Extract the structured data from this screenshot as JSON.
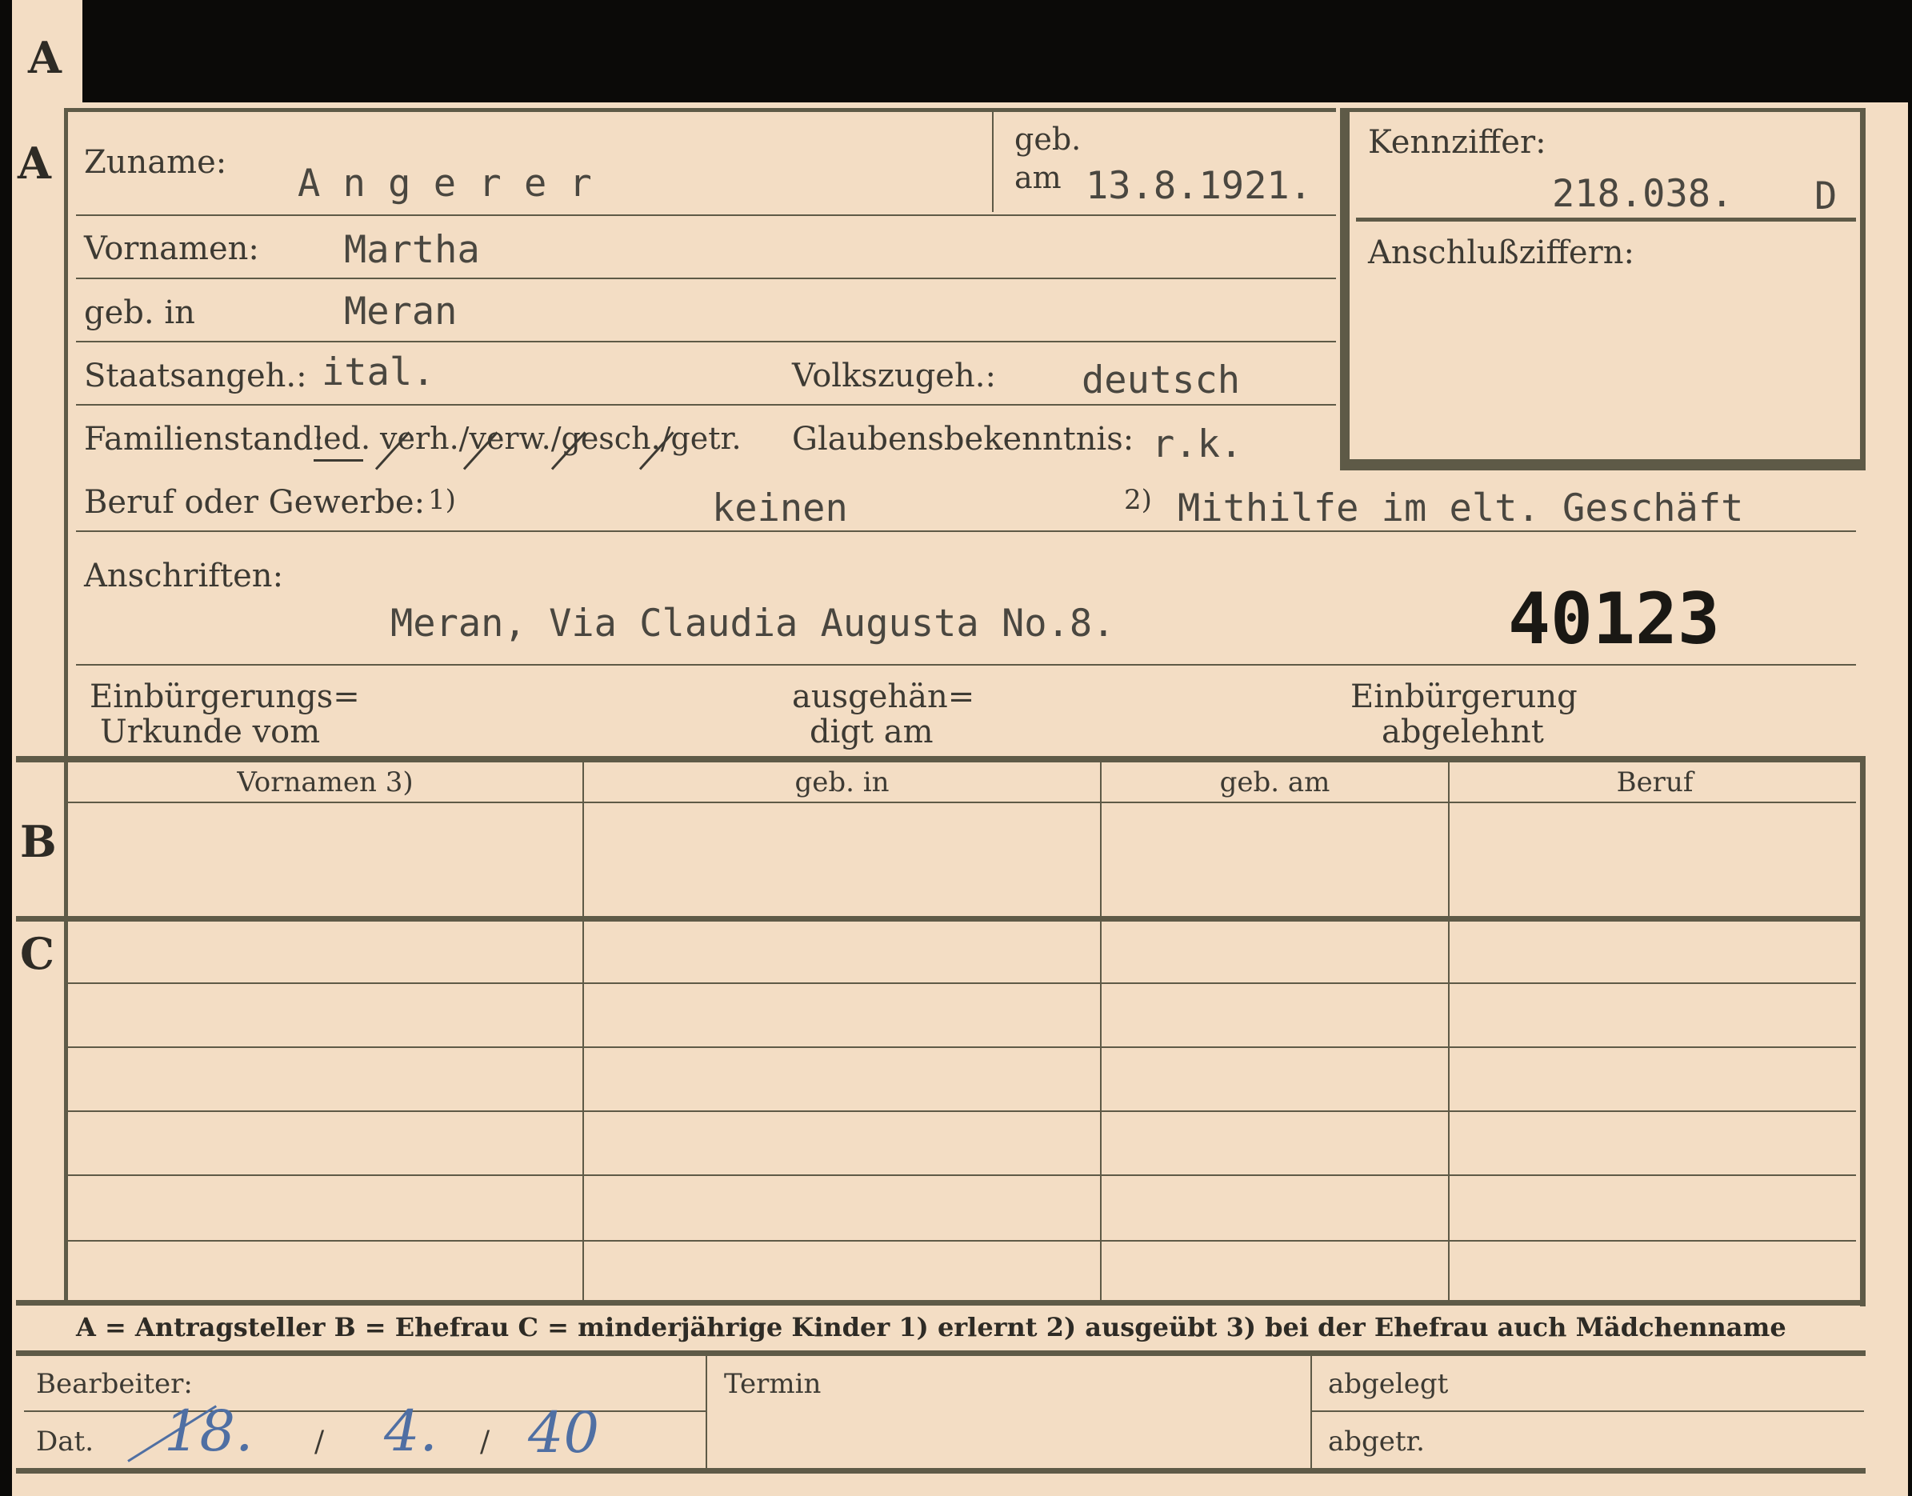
{
  "section_letters": {
    "a_tab": "A",
    "a": "A",
    "b": "B",
    "c": "C"
  },
  "header": {
    "surname_label": "Zuname:",
    "surname_value": "A n g e r e r",
    "birthdate_label_1": "geb.",
    "birthdate_label_2": "am",
    "birthdate_value": "13.8.1921.",
    "id_label": "Kennziffer:",
    "id_value": "218.038.",
    "id_suffix": "D",
    "additional_ids_label": "Anschlußziffern:"
  },
  "person": {
    "first_names_label": "Vornamen:",
    "first_names_value": "Martha",
    "birthplace_label": "geb. in",
    "birthplace_value": "Meran",
    "citizenship_label": "Staatsangeh.:",
    "citizenship_value": "ital.",
    "ethnicity_label": "Volkszugeh.:",
    "ethnicity_value": "deutsch",
    "marital_label": "Familienstand:",
    "marital_options": "led. / verh. / verw. / gesch. / getr.",
    "marital_selected": "led.",
    "marital_rest": "verh./verw./gesch./getr.",
    "religion_label": "Glaubensbekenntnis:",
    "religion_value": "r.k.",
    "occupation_label": "Beruf oder Gewerbe:",
    "occupation_note_1": "1)",
    "occupation_learned": "keinen",
    "occupation_note_2": "2)",
    "occupation_practiced": "Mithilfe im elt.  Geschäft",
    "address_label": "Anschriften:",
    "address_value": "Meran, Via Claudia Augusta No.8.",
    "stamp_number": "40123"
  },
  "naturalization": {
    "certificate_label_1": "Einbürgerungs=",
    "certificate_label_2": "Urkunde vom",
    "issued_label_1": "ausgehän=",
    "issued_label_2": "digt am",
    "refused_label_1": "Einbürgerung",
    "refused_label_2": "abgelehnt"
  },
  "table": {
    "columns": [
      "Vornamen 3)",
      "geb. in",
      "geb. am",
      "Beruf"
    ]
  },
  "legend": {
    "text": "A = Antragsteller   B = Ehefrau   C = minderjährige Kinder   1) erlernt   2) ausgeübt   3) bei der Ehefrau auch Mädchenname"
  },
  "footer": {
    "clerk_label": "Bearbeiter:",
    "date_label": "Dat.",
    "date_day": "18.",
    "date_sep_1": "/",
    "date_month": "4.",
    "date_sep_2": "/",
    "date_year": "40",
    "deadline_label": "Termin",
    "filed_label": "abgelegt",
    "signed_label": "abgetr."
  },
  "colors": {
    "card": "#f3ddc4",
    "ink": "#3d3a33",
    "rules": "#5e5a47",
    "handwriting": "#4f6fa3",
    "background": "#0b0a08"
  }
}
